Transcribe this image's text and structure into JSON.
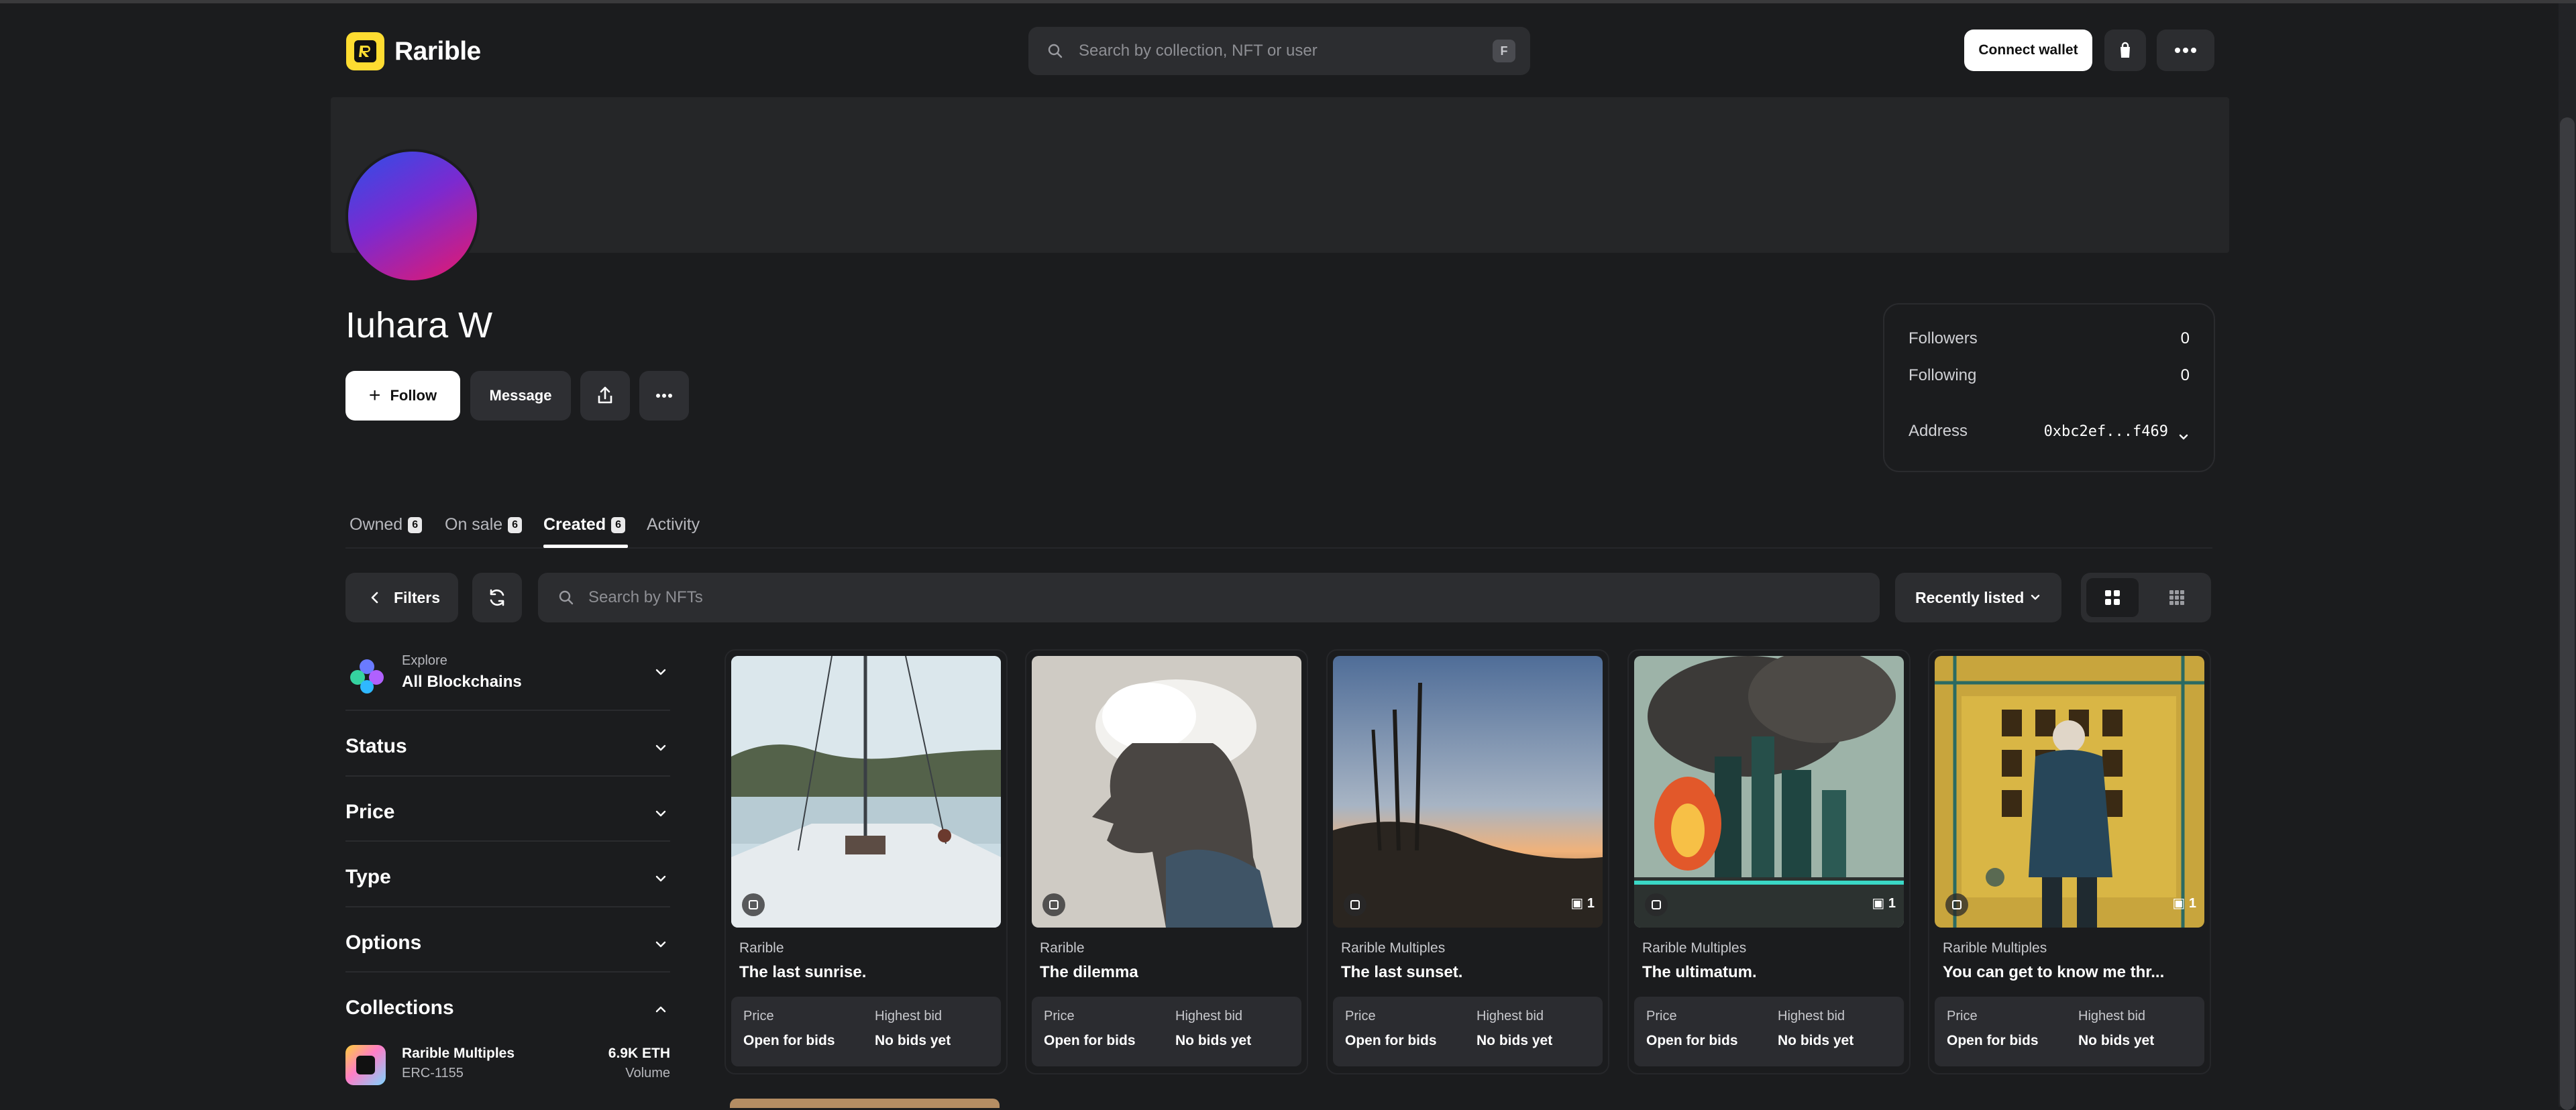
{
  "header": {
    "logo_text": "Rarible",
    "search_placeholder": "Search by collection, NFT or user",
    "search_shortcut": "F",
    "connect_wallet_label": "Connect wallet"
  },
  "profile": {
    "name": "Iuhara W",
    "follow_label": "Follow",
    "message_label": "Message",
    "stats": {
      "followers_label": "Followers",
      "followers_value": "0",
      "following_label": "Following",
      "following_value": "0",
      "address_label": "Address",
      "address_value": "0xbc2ef...f469"
    }
  },
  "tabs": [
    {
      "label": "Owned",
      "count": "6"
    },
    {
      "label": "On sale",
      "count": "6"
    },
    {
      "label": "Created",
      "count": "6",
      "active": true
    },
    {
      "label": "Activity"
    }
  ],
  "toolbar": {
    "filters_label": "Filters",
    "search_placeholder": "Search by NFTs",
    "sort_label": "Recently listed"
  },
  "sidebar": {
    "blockchain_small": "Explore",
    "blockchain_value": "All Blockchains",
    "facets": [
      "Status",
      "Price",
      "Type",
      "Options",
      "Collections"
    ],
    "collection": {
      "name": "Rarible Multiples",
      "standard": "ERC-1155",
      "volume": "6.9K ETH",
      "volume_label": "Volume"
    }
  },
  "cards": [
    {
      "collection": "Rarible",
      "title": "The last sunrise.",
      "price_label": "Price",
      "price": "Open for bids",
      "bid_label": "Highest bid",
      "bid": "No bids yet",
      "qty": ""
    },
    {
      "collection": "Rarible",
      "title": "The dilemma",
      "price_label": "Price",
      "price": "Open for bids",
      "bid_label": "Highest bid",
      "bid": "No bids yet",
      "qty": ""
    },
    {
      "collection": "Rarible Multiples",
      "title": "The last sunset.",
      "price_label": "Price",
      "price": "Open for bids",
      "bid_label": "Highest bid",
      "bid": "No bids yet",
      "qty": "1"
    },
    {
      "collection": "Rarible Multiples",
      "title": "The ultimatum.",
      "price_label": "Price",
      "price": "Open for bids",
      "bid_label": "Highest bid",
      "bid": "No bids yet",
      "qty": "1"
    },
    {
      "collection": "Rarible Multiples",
      "title": "You can get to know me thr...",
      "price_label": "Price",
      "price": "Open for bids",
      "bid_label": "Highest bid",
      "bid": "No bids yet",
      "qty": "1"
    }
  ],
  "colors": {
    "background": "#1b1c1e",
    "logo_yellow": "#fedc31",
    "surface": "#2c2d30"
  },
  "icons": [
    "search-icon",
    "bag-icon",
    "more-horizontal-icon",
    "plus-icon",
    "share-icon",
    "chevron-left-icon",
    "refresh-icon",
    "grid-large-icon",
    "grid-small-icon",
    "chevron-down-icon",
    "chevron-up-icon",
    "blockchain-icon"
  ]
}
